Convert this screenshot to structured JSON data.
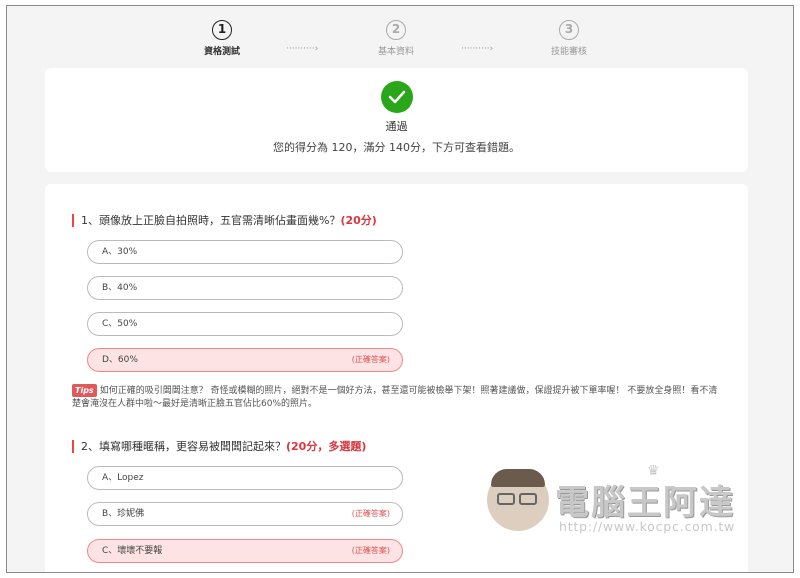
{
  "stepper": {
    "steps": [
      {
        "num": "1",
        "label": "資格測試"
      },
      {
        "num": "2",
        "label": "基本資料"
      },
      {
        "num": "3",
        "label": "技能審核"
      }
    ],
    "connector": "··········›"
  },
  "result": {
    "status": "通過",
    "score_text": "您的得分為 120，滿分 140分，下方可查看錯題。"
  },
  "questions": [
    {
      "title": "1、頭像放上正臉自拍照時，五官需清晰佔畫面幾%？",
      "points": "(20分)",
      "options": [
        {
          "label": "A、30%",
          "tag": ""
        },
        {
          "label": "B、40%",
          "tag": ""
        },
        {
          "label": "C、50%",
          "tag": ""
        },
        {
          "label": "D、60%",
          "tag": "(正確答案)"
        }
      ],
      "tip_badge": "Tips",
      "tip_text": "如何正確的吸引闆闆注意？ 奇怪或模糊的照片，絕對不是一個好方法，甚至還可能被檢舉下架！照著建議做，保證提升被下單率喔！ 不要放全身照！看不清楚會淹沒在人群中啦～最好是清晰正臉五官佔比60%的照片。"
    },
    {
      "title": "2、填寫哪種暱稱，更容易被闆闆記起來？",
      "points": "(20分，多選題)",
      "options": [
        {
          "label": "A、Lopez",
          "tag": ""
        },
        {
          "label": "B、珍妮佛",
          "tag": "(正確答案)"
        },
        {
          "label": "C、壞壞不要報",
          "tag": "(正確答案)"
        }
      ]
    }
  ],
  "watermark": {
    "title": "電腦王阿達",
    "url": "http://www.kocpc.com.tw"
  },
  "colors": {
    "accent": "#d9363e",
    "success": "#2aa61a",
    "correct_bg": "#fde3e3"
  }
}
